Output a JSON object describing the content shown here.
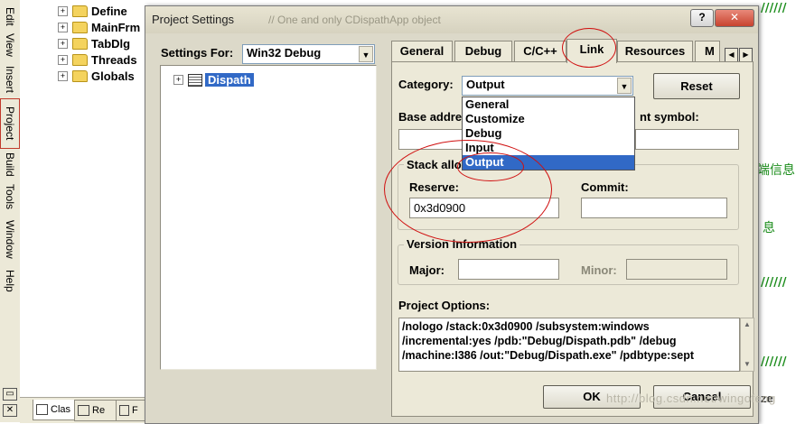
{
  "ide": {
    "menu": [
      "Edit",
      "View",
      "Insert",
      "Project",
      "Build",
      "Tools",
      "Window",
      "Help"
    ],
    "tree": [
      "Define",
      "MainFrm",
      "TabDlg",
      "Threads",
      "Globals"
    ],
    "bottom_tabs": [
      "Clas",
      "Re",
      "F"
    ],
    "right_text": {
      "comment_top": "//////",
      "cn1": "端信息",
      "cn2": "息",
      "comment_mid": "//////",
      "comment_low": "//////",
      "ze": "ze"
    },
    "close_x": "✕"
  },
  "dialog": {
    "title": "Project Settings",
    "help_btn": "?",
    "close_btn": "✕",
    "settings_for_label": "Settings For:",
    "settings_for_value": "Win32 Debug",
    "project_tree_item": "Dispath",
    "behind_text": "// One and only CDispathApp object",
    "tabs": [
      "General",
      "Debug",
      "C/C++",
      "Link",
      "Resources",
      "M"
    ],
    "active_tab": "Link",
    "category_label": "Category:",
    "category_value": "Output",
    "category_options": [
      "General",
      "Customize",
      "Debug",
      "Input",
      "Output"
    ],
    "reset_btn": "Reset",
    "base_address_label": "Base addre",
    "entry_symbol_label": "nt symbol:",
    "stack_group_title": "Stack allo",
    "reserve_label": "Reserve:",
    "reserve_value": "0x3d0900",
    "commit_label": "Commit:",
    "commit_value": "",
    "version_group_title": "Version information",
    "major_label": "Major:",
    "minor_label": "Minor:",
    "project_options_label": "Project Options:",
    "project_options_lines": [
      "/nologo /stack:0x3d0900 /subsystem:windows",
      "/incremental:yes /pdb:\"Debug/Dispath.pdb\" /debug",
      "/machine:I386 /out:\"Debug/Dispath.exe\" /pdbtype:sept"
    ],
    "ok_btn": "OK",
    "cancel_btn": "Cancel",
    "watermark": "http://blog.csdn.net/wingofeng"
  }
}
